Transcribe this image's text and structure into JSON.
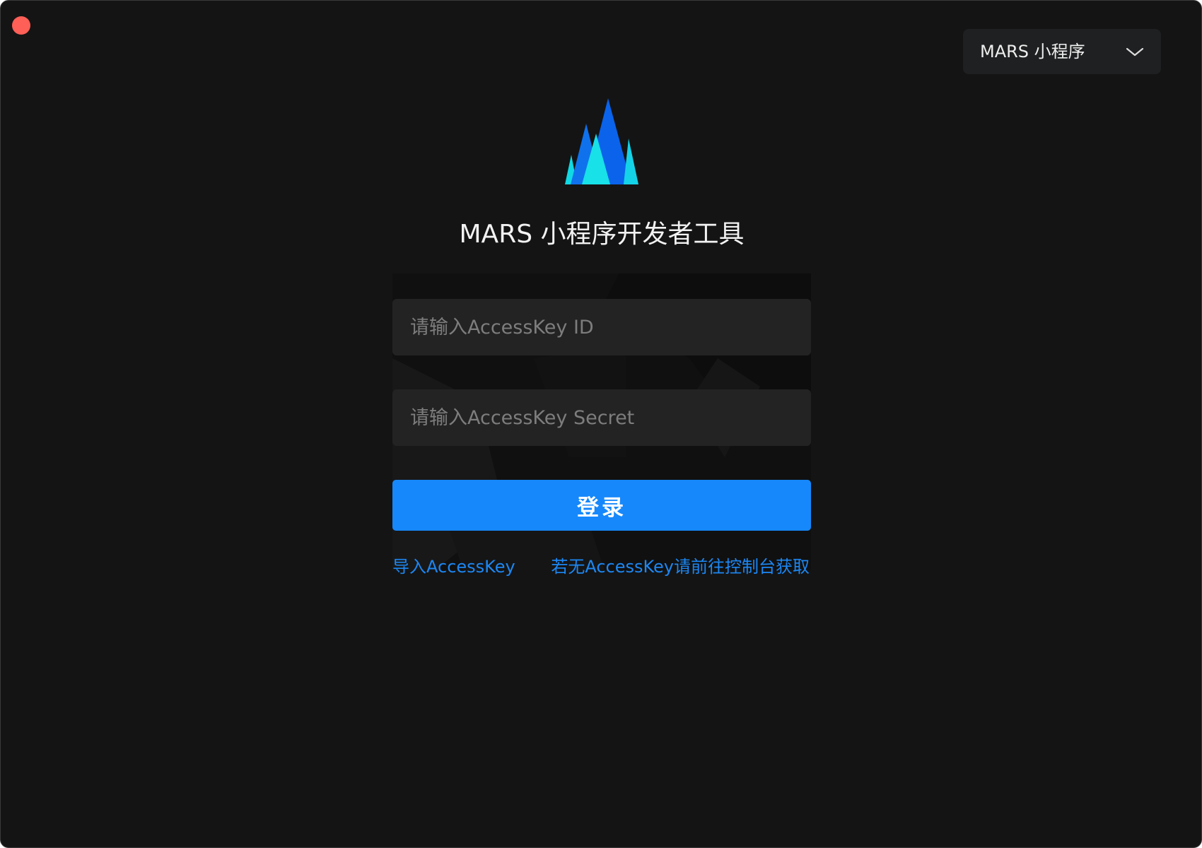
{
  "window": {
    "title": "MARS 小程序开发者工具"
  },
  "selector": {
    "value": "MARS 小程序"
  },
  "form": {
    "accesskey_id_placeholder": "请输入AccessKey ID",
    "accesskey_secret_placeholder": "请输入AccessKey Secret",
    "login_label": "登录"
  },
  "links": {
    "import_label": "导入AccessKey",
    "console_label": "若无AccessKey请前往控制台获取"
  },
  "colors": {
    "background": "#141414",
    "input_background": "#232324",
    "primary_button": "#1688fb",
    "link": "#1c87f3",
    "close_button": "#fe5f57"
  },
  "icons": {
    "close": "close-icon",
    "dropdown": "chevron-down-icon",
    "logo": "mars-logo"
  }
}
